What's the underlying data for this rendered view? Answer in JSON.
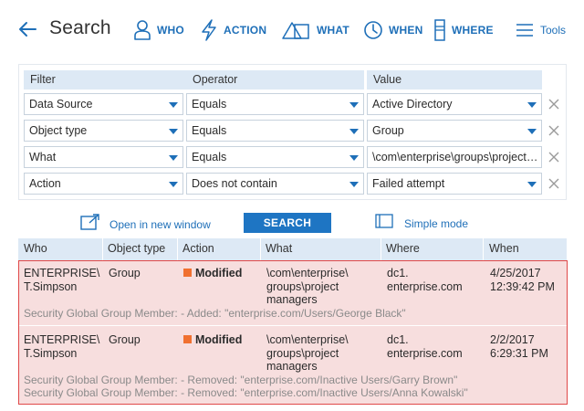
{
  "header": {
    "title": "Search",
    "nav": [
      {
        "label": "WHO",
        "icon": "person-icon"
      },
      {
        "label": "ACTION",
        "icon": "lightning-icon"
      },
      {
        "label": "WHAT",
        "icon": "shapes-icon"
      },
      {
        "label": "WHEN",
        "icon": "clock-icon"
      },
      {
        "label": "WHERE",
        "icon": "server-icon"
      }
    ],
    "tools_label": "Tools"
  },
  "filter": {
    "headers": {
      "filter": "Filter",
      "operator": "Operator",
      "value": "Value"
    },
    "rows": [
      {
        "filter": "Data Source",
        "operator": "Equals",
        "value": "Active Directory"
      },
      {
        "filter": "Object type",
        "operator": "Equals",
        "value": "Group"
      },
      {
        "filter": "What",
        "operator": "Equals",
        "value": "\\com\\enterprise\\groups\\project managers"
      },
      {
        "filter": "Action",
        "operator": "Does not contain",
        "value": "Failed attempt"
      }
    ]
  },
  "actions": {
    "open_new_window": "Open in new window",
    "search": "SEARCH",
    "simple_mode": "Simple mode"
  },
  "results": {
    "columns": [
      "Who",
      "Object type",
      "Action",
      "What",
      "Where",
      "When"
    ],
    "rows": [
      {
        "who_1": "ENTERPRISE\\",
        "who_2": "T.Simpson",
        "object_type": "Group",
        "action": "Modified",
        "what_1": "\\com\\enterprise\\",
        "what_2": "groups\\project",
        "what_3": "managers",
        "where_1": "dc1.",
        "where_2": "enterprise.com",
        "when_1": "4/25/2017",
        "when_2": "12:39:42 PM",
        "details": [
          "Security Global Group Member: - Added: \"enterprise.com/Users/George Black\""
        ]
      },
      {
        "who_1": "ENTERPRISE\\",
        "who_2": "T.Simpson",
        "object_type": "Group",
        "action": "Modified",
        "what_1": "\\com\\enterprise\\",
        "what_2": "groups\\project",
        "what_3": "managers",
        "where_1": "dc1.",
        "where_2": "enterprise.com",
        "when_1": "2/2/2017",
        "when_2": "6:29:31 PM",
        "details": [
          "Security Global Group Member: - Removed: \"enterprise.com/Inactive Users/Garry Brown\"",
          "Security Global Group Member: - Removed: \"enterprise.com/Inactive Users/Anna Kowalski\""
        ]
      }
    ]
  },
  "colors": {
    "accent": "#1e6fb8",
    "header_bg": "#dde9f5",
    "row_bg": "#f7dede",
    "row_border": "#e04848",
    "modified_marker": "#f07030"
  }
}
